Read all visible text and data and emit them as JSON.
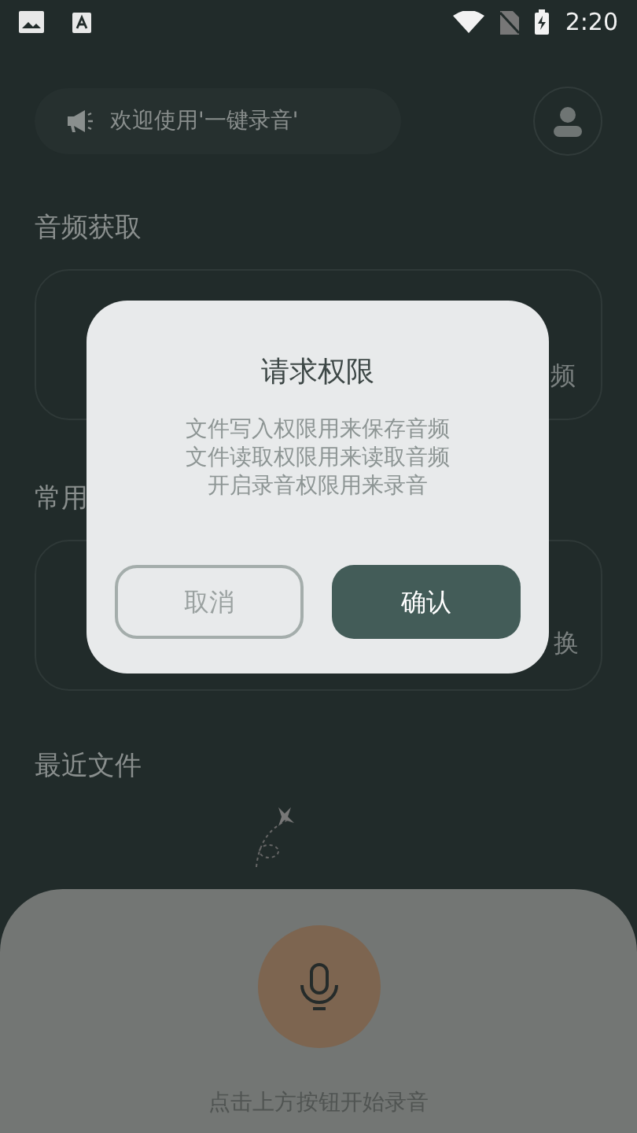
{
  "status_bar": {
    "time": "2:20"
  },
  "notice": {
    "text": "欢迎使用'一键录音'"
  },
  "sections": [
    {
      "title": "音频获取",
      "card_texts": [
        "频"
      ]
    },
    {
      "title": "常用",
      "card_texts": [
        "换"
      ]
    },
    {
      "title": "最近文件"
    }
  ],
  "bottom_sheet": {
    "hint": "点击上方按钮开始录音"
  },
  "dialog": {
    "title": "请求权限",
    "lines": [
      "文件写入权限用来保存音频",
      "文件读取权限用来读取音频",
      "开启录音权限用来录音"
    ],
    "buttons": [
      {
        "label": "取消",
        "kind": "secondary"
      },
      {
        "label": "确认",
        "kind": "primary"
      }
    ]
  }
}
